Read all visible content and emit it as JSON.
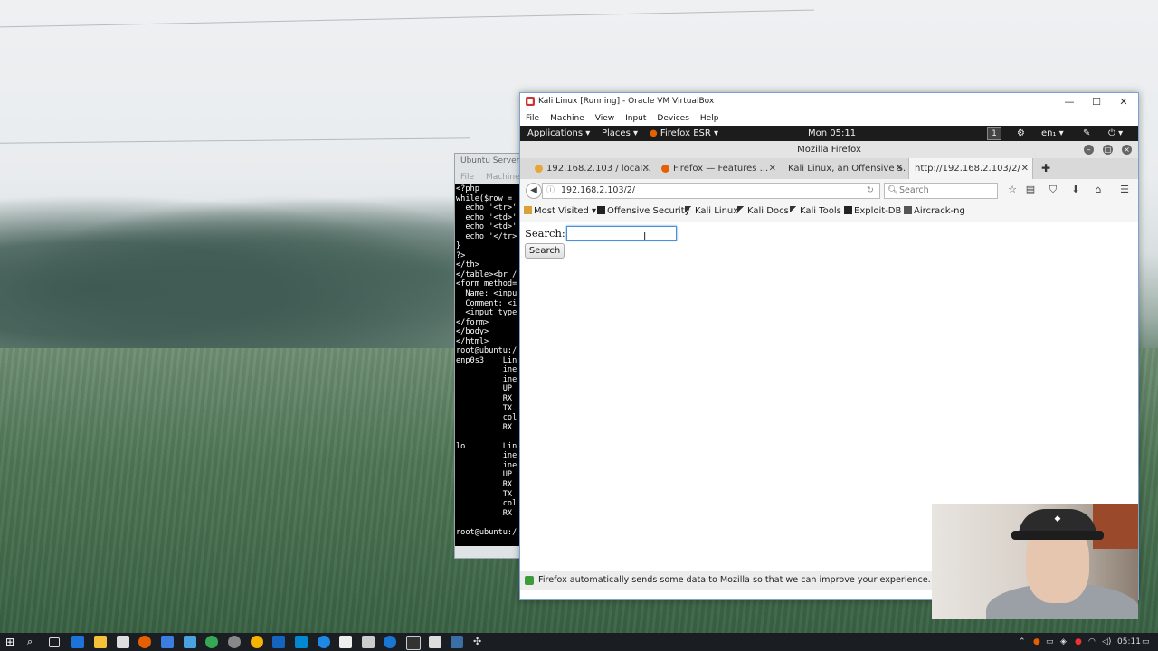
{
  "ubuntu_window": {
    "title": "Ubuntu Server",
    "menu": [
      "File",
      "Machine"
    ],
    "terminal_lines": [
      "<?php",
      "while($row = ",
      "  echo '<tr>'",
      "  echo '<td>'",
      "  echo '<td>'",
      "  echo '</tr>",
      "}",
      "?>",
      "</th>",
      "</table><br /",
      "<form method=",
      "  Name: <inpu",
      "  Comment: <i",
      "  <input type",
      "</form>",
      "</body>",
      "</html>",
      "root@ubuntu:/",
      "enp0s3    Lin",
      "          ine",
      "          ine",
      "          UP ",
      "          RX ",
      "          TX ",
      "          col",
      "          RX ",
      "",
      "lo        Lin",
      "          ine",
      "          ine",
      "          UP ",
      "          RX ",
      "          TX ",
      "          col",
      "          RX ",
      "",
      "root@ubuntu:/"
    ]
  },
  "vbox": {
    "title": "Kali Linux [Running] - Oracle VM VirtualBox",
    "menu": [
      "File",
      "Machine",
      "View",
      "Input",
      "Devices",
      "Help"
    ],
    "controls": {
      "minimize": "—",
      "maximize": "☐",
      "close": "✕"
    }
  },
  "kali_panel": {
    "applications": "Applications",
    "places": "Places",
    "firefox": "Firefox ESR",
    "clock": "Mon 05:11",
    "workspace": "1",
    "lang": "en₁"
  },
  "firefox": {
    "window_title": "Mozilla Firefox",
    "tabs": [
      {
        "label": "192.168.2.103 / local...",
        "active": false
      },
      {
        "label": "Firefox — Features ...",
        "active": false
      },
      {
        "label": "Kali Linux, an Offensive S...",
        "active": false
      },
      {
        "label": "http://192.168.2.103/2/",
        "active": true
      }
    ],
    "url": "192.168.2.103/2/",
    "search_placeholder": "Search",
    "bookmarks": [
      "Most Visited ▾",
      "Offensive Security",
      "Kali Linux",
      "Kali Docs",
      "Kali Tools",
      "Exploit-DB",
      "Aircrack-ng"
    ],
    "page": {
      "search_label": "Search:",
      "search_value": "",
      "search_button": "Search"
    },
    "notification": "Firefox automatically sends some data to Mozilla so that we can improve your experience."
  },
  "taskbar": {
    "time": "05:11"
  }
}
